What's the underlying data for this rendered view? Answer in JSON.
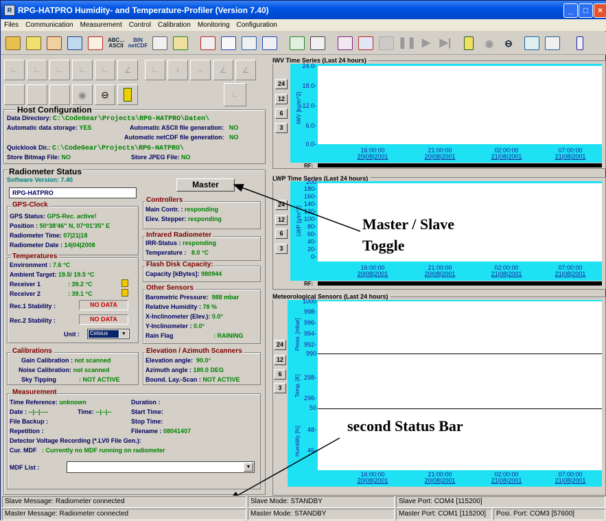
{
  "title": "RPG-HATPRO Humidity- and Temperature-Profiler (Version 7.40)",
  "menu": [
    "Files",
    "Communication",
    "Measurement",
    "Control",
    "Calibration",
    "Monitoring",
    "Configuration"
  ],
  "toolbar": {
    "abc": "ABC... ASCII",
    "bin": "BIN netCDF"
  },
  "host": {
    "title": "Host Configuration",
    "data_dir_label": "Data Directory:",
    "data_dir": "C:\\CodeGear\\Projects\\RPG-HATPRO\\Daten\\",
    "auto_store_label": "Automatic data storage:",
    "auto_store": "YES",
    "ascii_label": "Automatic ASCII file generation:",
    "ascii": "NO",
    "netcdf_label": "Automatic netCDF file generation:",
    "netcdf": "NO",
    "quicklook_label": "Quicklook Dir.:",
    "quicklook": "C:\\CodeGear\\Projects\\RPG-HATPRO\\",
    "bitmap_label": "Store Bitmap File:",
    "bitmap": "NO",
    "jpeg_label": "Store JPEG File:",
    "jpeg": "NO"
  },
  "radiometer": {
    "title": "Radiometer Status",
    "sw_label": "Software Version:",
    "sw": "7.40",
    "name": "RPG-HATPRO",
    "master_button": "Master"
  },
  "gps": {
    "title": "GPS-Clock",
    "status_label": "GPS Status:",
    "status": "GPS-Rec. active!",
    "pos_label": "Position :",
    "pos": "50°38'46\" N, 07°01'35\" E",
    "time_label": "Radiometer Time:",
    "time": "07|21|18",
    "date_label": "Radiometer Date :",
    "date": "14|04|2008"
  },
  "temps": {
    "title": "Temperatures",
    "env_label": "Environment   :",
    "env": "7.6 °C",
    "amb_label": "Ambient Target:",
    "amb": "19.5/ 19.5 °C",
    "r1_label": "Receiver 1",
    "r1": ":  39.2 °C",
    "r2_label": "Receiver 2",
    "r2": ":  39.1 °C",
    "s1_label": "Rec.1 Stability  :",
    "s2_label": "Rec.2 Stability  :",
    "nodata": "NO DATA",
    "unit_label": "Unit  :",
    "unit": "Celsius"
  },
  "controllers": {
    "title": "Controllers",
    "main_label": "Main Contr.  :",
    "main": "responding",
    "elev_label": "Elev. Stepper:",
    "elev": "responding"
  },
  "ir": {
    "title": "Infrared Radiometer",
    "irr_label": "IRR-Status    :",
    "irr": "responding",
    "temp_label": "Temperature :",
    "temp": "8.0 °C"
  },
  "flash": {
    "title": "Flash Disk Capacity:",
    "cap_label": "Capacity [kBytes]:",
    "cap": "980944"
  },
  "sensors": {
    "title": "Other Sensors",
    "baro_label": "Barometric Pressure:",
    "baro": "988 mbar",
    "rh_label": "Relative Humidity     :",
    "rh": "78 %",
    "xi_label": "X-Inclinometer (Elev.):",
    "xi": "0.0°",
    "yi_label": "Y-Inclinometer          :",
    "yi": "0.0°",
    "rain_label": "Rain Flag",
    "rain": ":  RAINING"
  },
  "calib": {
    "title": "Calibrations",
    "gain_label": "Gain Calibration :",
    "gain": "not scanned",
    "noise_label": "Noise Calibration:",
    "noise": "not scanned",
    "sky_label": "Sky Tipping",
    "sky": ":  NOT ACTIVE"
  },
  "scan": {
    "title": "Elevation / Azimuth Scanners",
    "elev_label": "Elevation angle:",
    "elev": "90.0°",
    "az_label": "Azimuth angle  :",
    "az": "180.0 DEG",
    "bl_label": "Bound. Lay.-Scan :",
    "bl": "NOT ACTIVE"
  },
  "meas": {
    "title": "Measurement",
    "tref_label": "Time Reference:",
    "tref": "unknown",
    "dur_label": "Duration  :",
    "date_label": "Date  :",
    "date": "--|--|----",
    "time_label": "Time:",
    "time": "--|--|--",
    "start_label": "Start Time:",
    "backup_label": "File Backup  :",
    "stop_label": "Stop Time:",
    "rep_label": "Repetition   :",
    "fname_label": "Filename  :",
    "fname": "08041407",
    "det": "Detector Voltage Recording (*.LV0 File Gen.):",
    "mdf_label": "Cur. MDF",
    "mdf": ":  Currently no MDF running on radiometer",
    "mdflist_label": "MDF List     :"
  },
  "charts": {
    "iwv": {
      "title": "IWV Time Series (Last 24 hours)",
      "ylabel": "IWV [kg/m^2]",
      "yticks": [
        "24.0-",
        "18.0-",
        "12.0-",
        "6.0-",
        "0.0-"
      ]
    },
    "lwp": {
      "title": "LWP Time Series (Last 24 hours)",
      "ylabel": "LWP [g/m^2]",
      "yticks": [
        "200",
        "180-",
        "160-",
        "140-",
        "120-",
        "100-",
        "80-",
        "60-",
        "40-",
        "20-",
        "0-"
      ]
    },
    "met": {
      "title": "Meteorological Sensors (Last 24 hours)",
      "press_label": "Press. [mbar]",
      "press_ticks": [
        "1000",
        "998-",
        "996-",
        "994-",
        "992-",
        "990"
      ],
      "temp_label": "Temp. [K]",
      "temp_ticks": [
        "298-",
        "296-",
        "50"
      ],
      "hum_label": "Humidity [%]",
      "hum_ticks": [
        "48-",
        "46-"
      ]
    },
    "xticks": [
      {
        "t": "16:00:00",
        "d": "20|08|2001"
      },
      {
        "t": "21:00:00",
        "d": "20|08|2001"
      },
      {
        "t": "02:00:00",
        "d": "21|08|2001"
      },
      {
        "t": "07:00:00",
        "d": "21|08|2001"
      }
    ],
    "range_buttons": [
      "24",
      "12",
      "6",
      "3"
    ],
    "rf": "RF:"
  },
  "annotations": {
    "toggle1": "Master / Slave",
    "toggle2": "Toggle",
    "status_bar": "second Status Bar"
  },
  "statusbar": {
    "slave_msg": "Slave Message: Radiometer connected",
    "slave_mode": "Slave Mode: STANDBY",
    "slave_port": "Slave Port: COM4 [115200]",
    "master_msg": "Master Message: Radiometer connected",
    "master_mode": "Master Mode: STANDBY",
    "master_port": "Master Port: COM1 [115200]",
    "posi_port": "Posi. Port: COM3 [57600]"
  }
}
